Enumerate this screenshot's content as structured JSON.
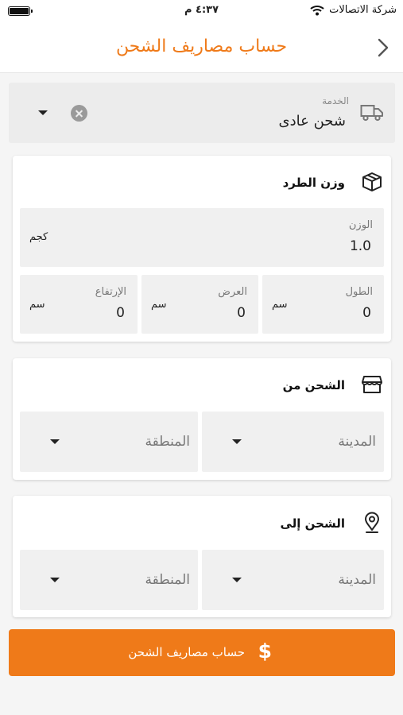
{
  "status_bar": {
    "carrier": "شركة الاتصالات",
    "time": "٤:٣٧ م"
  },
  "navbar": {
    "title": "حساب مصاريف الشحن",
    "back_icon": "chevron-right-icon"
  },
  "service": {
    "label": "الخدمة",
    "value": "شحن عادى",
    "icon": "truck-icon"
  },
  "parcel_weight": {
    "title": "وزن الطرد",
    "icon": "box-icon",
    "weight": {
      "label": "الوزن",
      "value": "1.0",
      "unit": "كجم"
    },
    "length": {
      "label": "الطول",
      "value": "0",
      "unit": "سم"
    },
    "width": {
      "label": "العرض",
      "value": "0",
      "unit": "سم"
    },
    "height": {
      "label": "الإرتفاع",
      "value": "0",
      "unit": "سم"
    }
  },
  "ship_from": {
    "title": "الشحن من",
    "icon": "store-icon",
    "city_placeholder": "المدينة",
    "region_placeholder": "المنطقة"
  },
  "ship_to": {
    "title": "الشحن إلى",
    "icon": "location-pin-icon",
    "city_placeholder": "المدينة",
    "region_placeholder": "المنطقة"
  },
  "submit": {
    "label": "حساب مصاريف الشحن",
    "icon": "dollar-icon"
  },
  "colors": {
    "accent": "#ef7a19",
    "field_bg": "#f0f0f0",
    "page_bg": "#f5f5f5"
  }
}
